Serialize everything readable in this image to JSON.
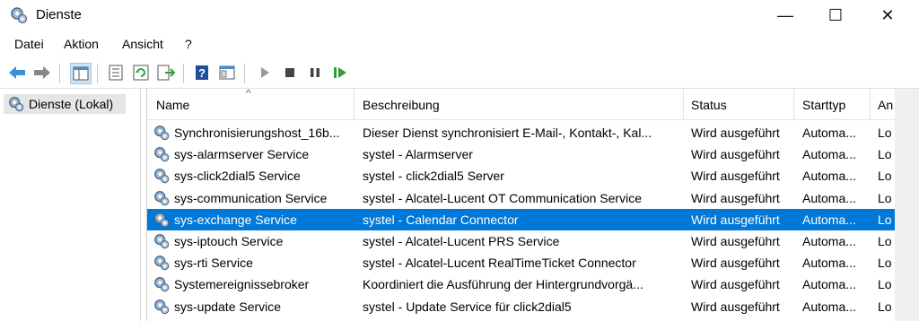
{
  "window": {
    "title": "Dienste",
    "minimize": "—",
    "maximize": "☐",
    "close": "✕"
  },
  "menu": [
    "Datei",
    "Aktion",
    "Ansicht",
    "?"
  ],
  "toolbar_icons": [
    "back-icon",
    "forward-icon",
    "show-hide-tree-icon",
    "properties-icon",
    "refresh-icon",
    "export-list-icon",
    "help-icon",
    "console-icon",
    "start-icon",
    "stop-icon",
    "pause-icon",
    "restart-icon"
  ],
  "tree": {
    "label": "Dienste (Lokal)"
  },
  "columns": [
    "Name",
    "Beschreibung",
    "Status",
    "Starttyp",
    "An"
  ],
  "rows": [
    {
      "name": "Synchronisierungshost_16b...",
      "desc": "Dieser Dienst synchronisiert E-Mail-, Kontakt-, Kal...",
      "status": "Wird ausgeführt",
      "start": "Automa...",
      "an": "Lo"
    },
    {
      "name": "sys-alarmserver Service",
      "desc": "systel - Alarmserver",
      "status": "Wird ausgeführt",
      "start": "Automa...",
      "an": "Lo"
    },
    {
      "name": "sys-click2dial5 Service",
      "desc": "systel - click2dial5 Server",
      "status": "Wird ausgeführt",
      "start": "Automa...",
      "an": "Lo"
    },
    {
      "name": "sys-communication Service",
      "desc": "systel - Alcatel-Lucent OT Communication Service",
      "status": "Wird ausgeführt",
      "start": "Automa...",
      "an": "Lo"
    },
    {
      "name": "sys-exchange Service",
      "desc": "systel - Calendar Connector",
      "status": "Wird ausgeführt",
      "start": "Automa...",
      "an": "Lo",
      "selected": true
    },
    {
      "name": "sys-iptouch Service",
      "desc": "systel - Alcatel-Lucent PRS Service",
      "status": "Wird ausgeführt",
      "start": "Automa...",
      "an": "Lo"
    },
    {
      "name": "sys-rti Service",
      "desc": "systel - Alcatel-Lucent  RealTimeTicket Connector",
      "status": "Wird ausgeführt",
      "start": "Automa...",
      "an": "Lo"
    },
    {
      "name": "Systemereignissebroker",
      "desc": "Koordiniert die Ausführung der Hintergrundvorgä...",
      "status": "Wird ausgeführt",
      "start": "Automa...",
      "an": "Lo"
    },
    {
      "name": "sys-update Service",
      "desc": "systel - Update Service für click2dial5",
      "status": "Wird ausgeführt",
      "start": "Automa...",
      "an": "Lo"
    }
  ],
  "colors": {
    "selection": "#0078d7",
    "accent_green": "#2e9e3a",
    "accent_blue": "#1e6fc2"
  }
}
